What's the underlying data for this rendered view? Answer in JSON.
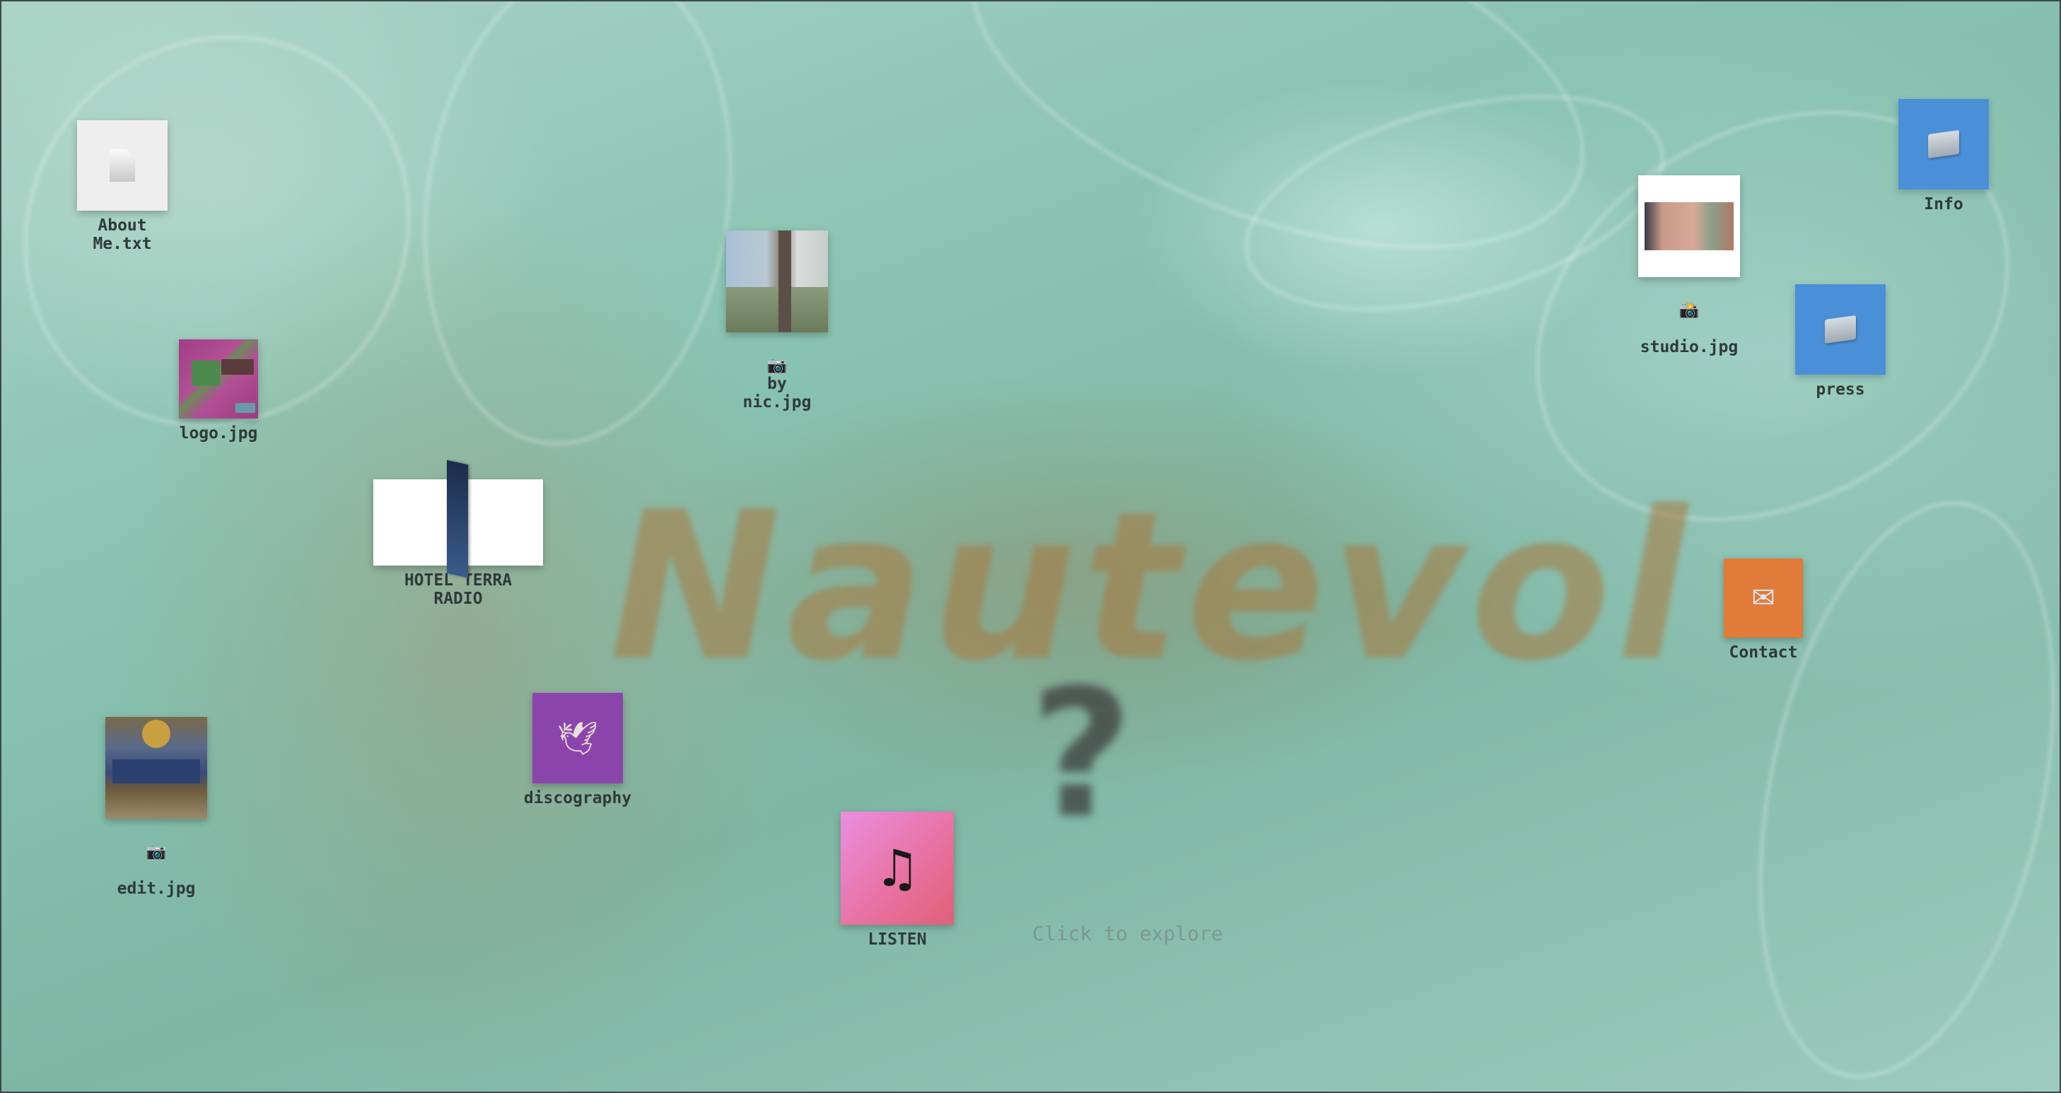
{
  "desktop": {
    "brand": "Nautevol",
    "mystery": "?",
    "hint": "Click to explore"
  },
  "icons": {
    "about": {
      "label": "About\nMe.txt",
      "icon": "document-icon"
    },
    "logo": {
      "label": "logo.jpg",
      "icon": "image-thumbnail"
    },
    "hotel": {
      "label": "HOTEL TERRA\nRADIO",
      "icon": "video-thumbnail"
    },
    "edit": {
      "prefix": "📷",
      "label": "edit.jpg",
      "icon": "image-thumbnail"
    },
    "discography": {
      "label": "discography",
      "glyph": "🕊",
      "icon": "dove-icon",
      "color": "#8b44ac"
    },
    "bynic": {
      "prefix": "📷",
      "label": "by\nnic.jpg",
      "icon": "image-thumbnail"
    },
    "listen": {
      "label": "LISTEN",
      "glyph": "♫",
      "icon": "music-note-icon"
    },
    "studio": {
      "prefix": "📸",
      "label": "studio.jpg",
      "icon": "image-thumbnail"
    },
    "info": {
      "label": "Info",
      "icon": "folder-icon",
      "color": "#4a90d9"
    },
    "press": {
      "label": "press",
      "icon": "folder-icon",
      "color": "#4a90d9"
    },
    "contact": {
      "label": "Contact",
      "glyph": "✉",
      "icon": "mail-icon",
      "color": "#e07b39"
    }
  }
}
